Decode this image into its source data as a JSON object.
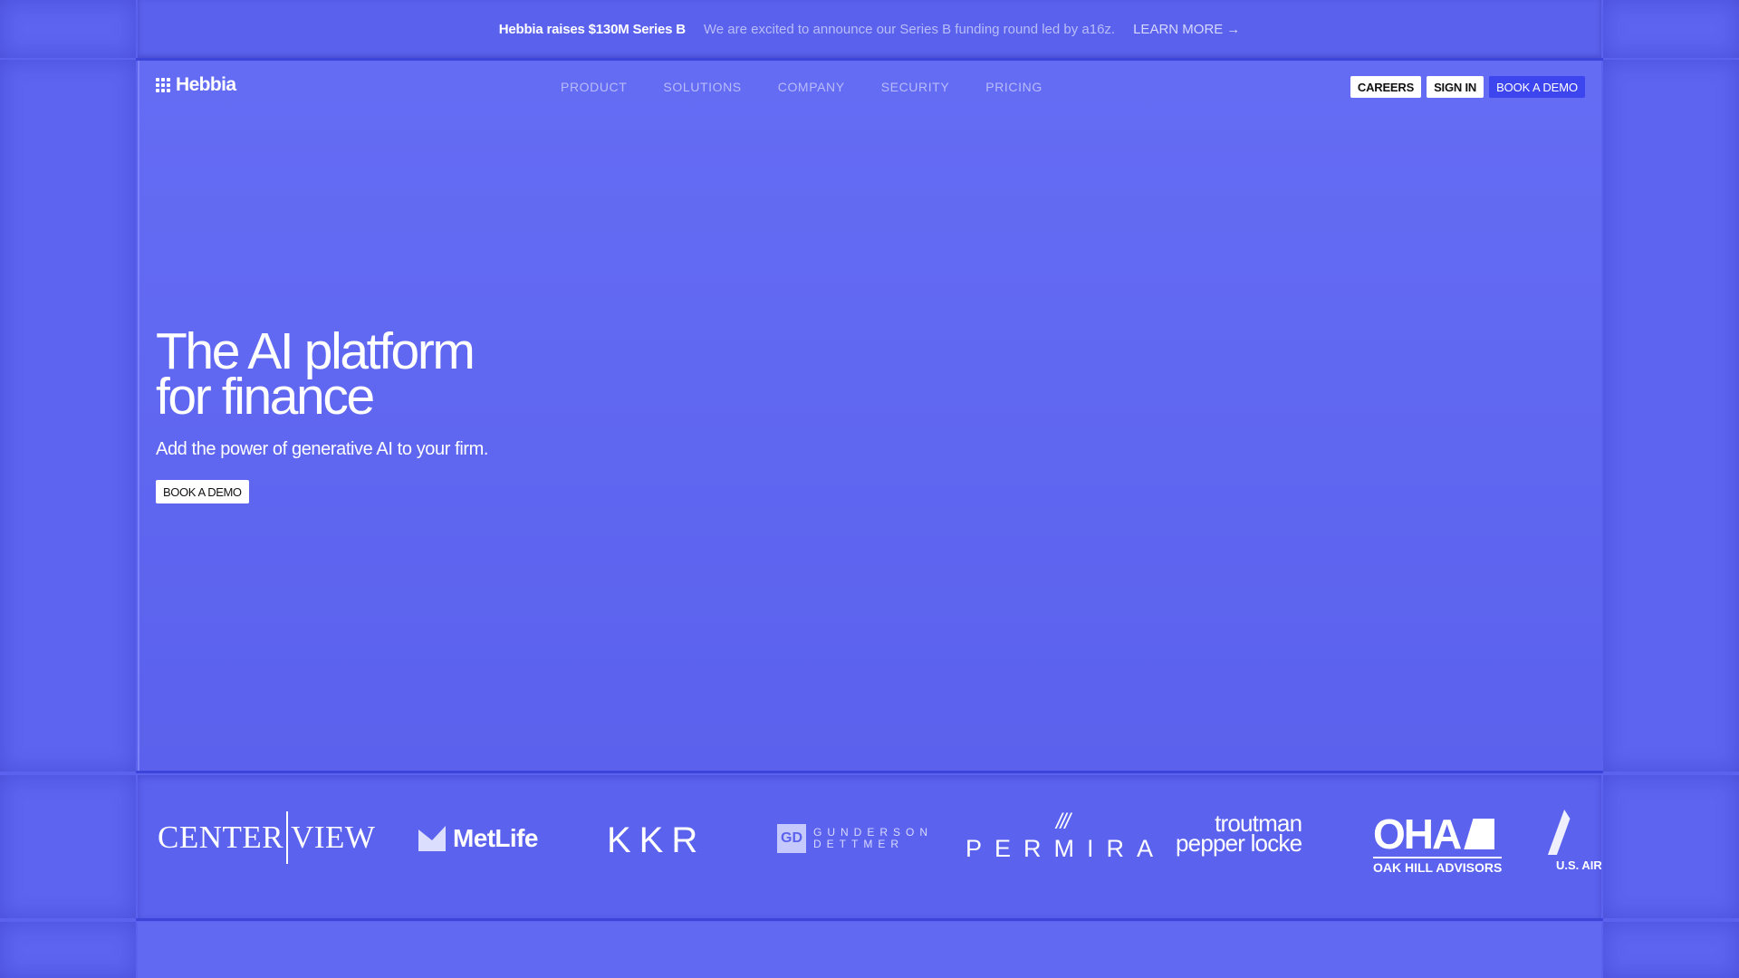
{
  "announcement": {
    "headline": "Hebbia raises $130M Series B",
    "message": "We are excited to announce our Series B funding round led by a16z.",
    "link": "LEARN MORE",
    "link_arrow": "→"
  },
  "brand": {
    "name": "Hebbia"
  },
  "nav": {
    "items": [
      {
        "label": "PRODUCT"
      },
      {
        "label": "SOLUTIONS"
      },
      {
        "label": "COMPANY"
      },
      {
        "label": "SECURITY"
      },
      {
        "label": "PRICING"
      }
    ],
    "careers": "CAREERS",
    "sign_in": "SIGN IN",
    "book_demo": "BOOK A DEMO"
  },
  "hero": {
    "title_line1": "The AI platform",
    "title_line2": "for finance",
    "subtitle": "Add the power of generative AI to your firm.",
    "cta": "BOOK A DEMO"
  },
  "customers": {
    "centerview_a": "CENTER",
    "centerview_b": "VIEW",
    "metlife": "MetLife",
    "kkr": "KKR",
    "gunderson_line1": "GUNDERSON",
    "gunderson_line2": "DETTMER",
    "permira": "PERMIRA",
    "troutman_line1": "troutman",
    "troutman_line2": "pepper locke",
    "oha_big": "OHA",
    "oha_small": "OAK HILL ADVISORS",
    "usaf": "U.S. AIR"
  },
  "colors": {
    "background": "#5a62ee",
    "accent_button": "#3d45ee",
    "muted_text": "#b9bdfa"
  }
}
